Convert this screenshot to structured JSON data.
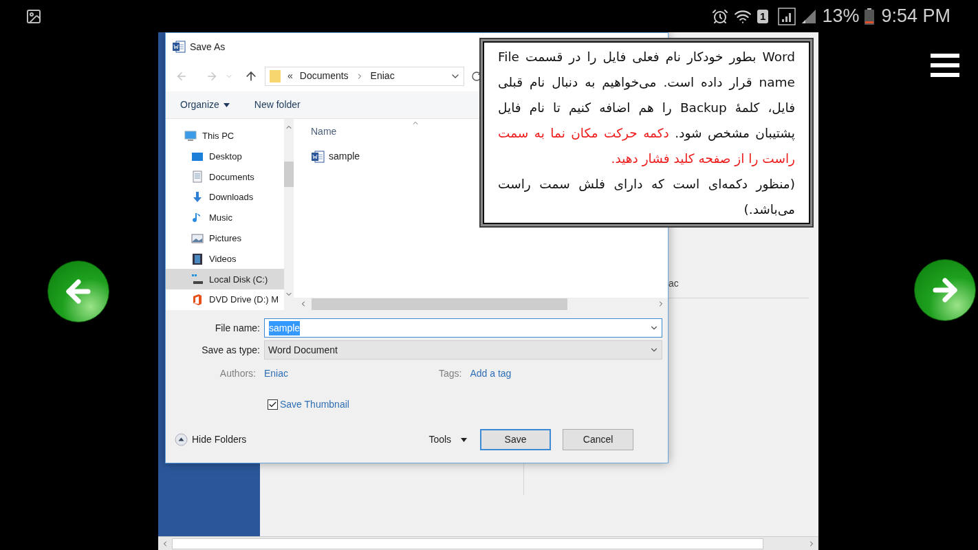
{
  "status_bar": {
    "sim_slot": "1",
    "battery": "13%",
    "time": "9:54 PM"
  },
  "background": {
    "partial_text": "ac"
  },
  "dialog": {
    "title": "Save As",
    "address": {
      "overflow": "«",
      "parts": [
        "Documents",
        "Eniac"
      ]
    },
    "toolbar": [
      {
        "label": "Organize",
        "kind": "menu"
      },
      {
        "label": "New folder",
        "kind": "button"
      }
    ],
    "nav_tree": [
      {
        "label": "This PC",
        "kind": "pc",
        "selected": false,
        "children": [
          {
            "label": "Desktop",
            "kind": "desktop",
            "selected": false
          },
          {
            "label": "Documents",
            "kind": "documents",
            "selected": false
          },
          {
            "label": "Downloads",
            "kind": "downloads",
            "selected": false
          },
          {
            "label": "Music",
            "kind": "music",
            "selected": false
          },
          {
            "label": "Pictures",
            "kind": "pictures",
            "selected": false
          },
          {
            "label": "Videos",
            "kind": "videos",
            "selected": false
          },
          {
            "label": "Local Disk (C:)",
            "kind": "disk",
            "selected": true
          },
          {
            "label": "DVD Drive (D:) M",
            "kind": "dvd",
            "selected": false
          }
        ]
      }
    ],
    "column_header": "Name",
    "files": [
      {
        "name": "sample"
      }
    ],
    "file_name": {
      "label": "File name:",
      "value": "sample",
      "text_selected": true
    },
    "save_as_type": {
      "label": "Save as type:",
      "value": "Word Document"
    },
    "authors": {
      "label": "Authors:",
      "value": "Eniac"
    },
    "tags": {
      "label": "Tags:",
      "value": "Add a tag"
    },
    "thumbnail": {
      "label": "Save Thumbnail",
      "checked": true
    },
    "hide_folders": "Hide Folders",
    "tools": "Tools",
    "buttons": [
      {
        "label": "Save",
        "default": true
      },
      {
        "label": "Cancel",
        "default": false
      }
    ]
  },
  "callout": {
    "paragraphs": [
      [
        {
          "text": "Word بطور خودکار نام فعلی فایل را در قسمت File name قرار داده است. می‌خواهیم به دنبال نام قبلی فایل، کلمهٔ Backup را هم اضافه کنیم تا نام فایل پشتیبان مشخص شود. ",
          "emphasis": false
        },
        {
          "text": "دکمه حرکت مکان نما به سمت راست را از صفحه کلید  فشار دهید.",
          "emphasis": true
        }
      ],
      [
        {
          "text": "(منظور دکمه‌ای است که دارای فلش سمت راست می‌باشد.)",
          "emphasis": false
        }
      ]
    ]
  }
}
